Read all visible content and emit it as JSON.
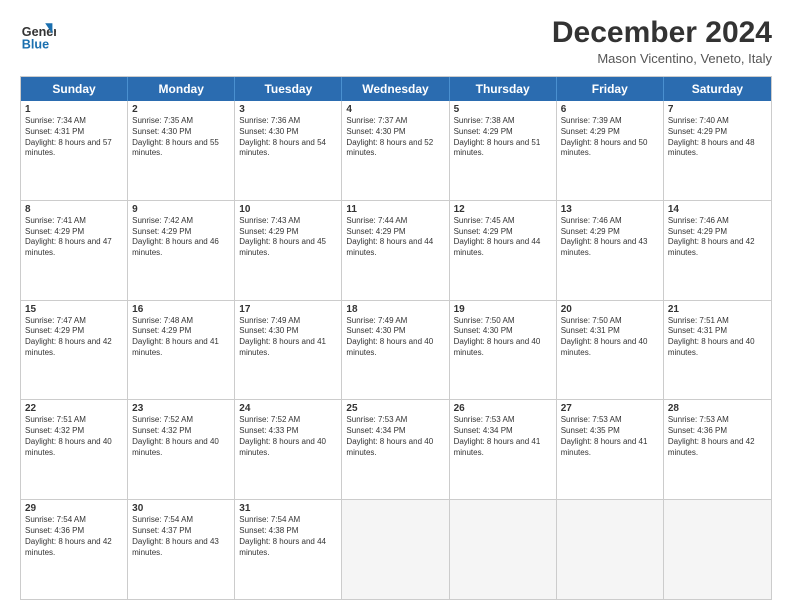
{
  "header": {
    "logo_line1": "General",
    "logo_line2": "Blue",
    "month_title": "December 2024",
    "location": "Mason Vicentino, Veneto, Italy"
  },
  "days_of_week": [
    "Sunday",
    "Monday",
    "Tuesday",
    "Wednesday",
    "Thursday",
    "Friday",
    "Saturday"
  ],
  "weeks": [
    [
      {
        "day": 1,
        "sunrise": "7:34 AM",
        "sunset": "4:31 PM",
        "daylight": "8 hours and 57 minutes."
      },
      {
        "day": 2,
        "sunrise": "7:35 AM",
        "sunset": "4:30 PM",
        "daylight": "8 hours and 55 minutes."
      },
      {
        "day": 3,
        "sunrise": "7:36 AM",
        "sunset": "4:30 PM",
        "daylight": "8 hours and 54 minutes."
      },
      {
        "day": 4,
        "sunrise": "7:37 AM",
        "sunset": "4:30 PM",
        "daylight": "8 hours and 52 minutes."
      },
      {
        "day": 5,
        "sunrise": "7:38 AM",
        "sunset": "4:29 PM",
        "daylight": "8 hours and 51 minutes."
      },
      {
        "day": 6,
        "sunrise": "7:39 AM",
        "sunset": "4:29 PM",
        "daylight": "8 hours and 50 minutes."
      },
      {
        "day": 7,
        "sunrise": "7:40 AM",
        "sunset": "4:29 PM",
        "daylight": "8 hours and 48 minutes."
      }
    ],
    [
      {
        "day": 8,
        "sunrise": "7:41 AM",
        "sunset": "4:29 PM",
        "daylight": "8 hours and 47 minutes."
      },
      {
        "day": 9,
        "sunrise": "7:42 AM",
        "sunset": "4:29 PM",
        "daylight": "8 hours and 46 minutes."
      },
      {
        "day": 10,
        "sunrise": "7:43 AM",
        "sunset": "4:29 PM",
        "daylight": "8 hours and 45 minutes."
      },
      {
        "day": 11,
        "sunrise": "7:44 AM",
        "sunset": "4:29 PM",
        "daylight": "8 hours and 44 minutes."
      },
      {
        "day": 12,
        "sunrise": "7:45 AM",
        "sunset": "4:29 PM",
        "daylight": "8 hours and 44 minutes."
      },
      {
        "day": 13,
        "sunrise": "7:46 AM",
        "sunset": "4:29 PM",
        "daylight": "8 hours and 43 minutes."
      },
      {
        "day": 14,
        "sunrise": "7:46 AM",
        "sunset": "4:29 PM",
        "daylight": "8 hours and 42 minutes."
      }
    ],
    [
      {
        "day": 15,
        "sunrise": "7:47 AM",
        "sunset": "4:29 PM",
        "daylight": "8 hours and 42 minutes."
      },
      {
        "day": 16,
        "sunrise": "7:48 AM",
        "sunset": "4:29 PM",
        "daylight": "8 hours and 41 minutes."
      },
      {
        "day": 17,
        "sunrise": "7:49 AM",
        "sunset": "4:30 PM",
        "daylight": "8 hours and 41 minutes."
      },
      {
        "day": 18,
        "sunrise": "7:49 AM",
        "sunset": "4:30 PM",
        "daylight": "8 hours and 40 minutes."
      },
      {
        "day": 19,
        "sunrise": "7:50 AM",
        "sunset": "4:30 PM",
        "daylight": "8 hours and 40 minutes."
      },
      {
        "day": 20,
        "sunrise": "7:50 AM",
        "sunset": "4:31 PM",
        "daylight": "8 hours and 40 minutes."
      },
      {
        "day": 21,
        "sunrise": "7:51 AM",
        "sunset": "4:31 PM",
        "daylight": "8 hours and 40 minutes."
      }
    ],
    [
      {
        "day": 22,
        "sunrise": "7:51 AM",
        "sunset": "4:32 PM",
        "daylight": "8 hours and 40 minutes."
      },
      {
        "day": 23,
        "sunrise": "7:52 AM",
        "sunset": "4:32 PM",
        "daylight": "8 hours and 40 minutes."
      },
      {
        "day": 24,
        "sunrise": "7:52 AM",
        "sunset": "4:33 PM",
        "daylight": "8 hours and 40 minutes."
      },
      {
        "day": 25,
        "sunrise": "7:53 AM",
        "sunset": "4:34 PM",
        "daylight": "8 hours and 40 minutes."
      },
      {
        "day": 26,
        "sunrise": "7:53 AM",
        "sunset": "4:34 PM",
        "daylight": "8 hours and 41 minutes."
      },
      {
        "day": 27,
        "sunrise": "7:53 AM",
        "sunset": "4:35 PM",
        "daylight": "8 hours and 41 minutes."
      },
      {
        "day": 28,
        "sunrise": "7:53 AM",
        "sunset": "4:36 PM",
        "daylight": "8 hours and 42 minutes."
      }
    ],
    [
      {
        "day": 29,
        "sunrise": "7:54 AM",
        "sunset": "4:36 PM",
        "daylight": "8 hours and 42 minutes."
      },
      {
        "day": 30,
        "sunrise": "7:54 AM",
        "sunset": "4:37 PM",
        "daylight": "8 hours and 43 minutes."
      },
      {
        "day": 31,
        "sunrise": "7:54 AM",
        "sunset": "4:38 PM",
        "daylight": "8 hours and 44 minutes."
      },
      null,
      null,
      null,
      null
    ]
  ]
}
